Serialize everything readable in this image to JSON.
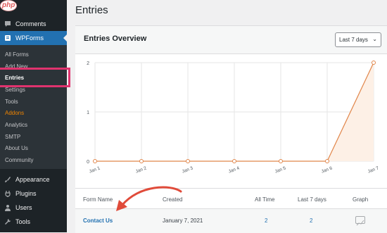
{
  "sidebar": {
    "watermark": "php",
    "comments": "Comments",
    "wpforms": "WPForms",
    "sub": [
      "All Forms",
      "Add New",
      "Entries",
      "Settings",
      "Tools",
      "Addons",
      "Analytics",
      "SMTP",
      "About Us",
      "Community"
    ],
    "bottom": [
      "Appearance",
      "Plugins",
      "Users",
      "Tools"
    ]
  },
  "page": {
    "title": "Entries"
  },
  "overview": {
    "title": "Entries Overview",
    "range": "Last 7 days"
  },
  "chart_data": {
    "type": "area",
    "categories": [
      "Jan 1",
      "Jan 2",
      "Jan 3",
      "Jan 4",
      "Jan 5",
      "Jan 6",
      "Jan 7"
    ],
    "values": [
      0,
      0,
      0,
      0,
      0,
      0,
      2
    ],
    "yticks": [
      "0",
      "1",
      "2"
    ],
    "ylim": [
      0,
      2
    ],
    "grid": true,
    "color": "#e1864a",
    "fill": "#fdf0e6"
  },
  "table": {
    "headers": [
      "Form Name",
      "Created",
      "All Time",
      "Last 7 days",
      "Graph"
    ],
    "rows": [
      {
        "name": "Contact Us",
        "created": "January 7, 2021",
        "all_time": "2",
        "last7": "2"
      }
    ]
  },
  "colors": {
    "accent": "#2271b1",
    "highlight": "#e0336e",
    "arrow": "#e04b3a"
  }
}
